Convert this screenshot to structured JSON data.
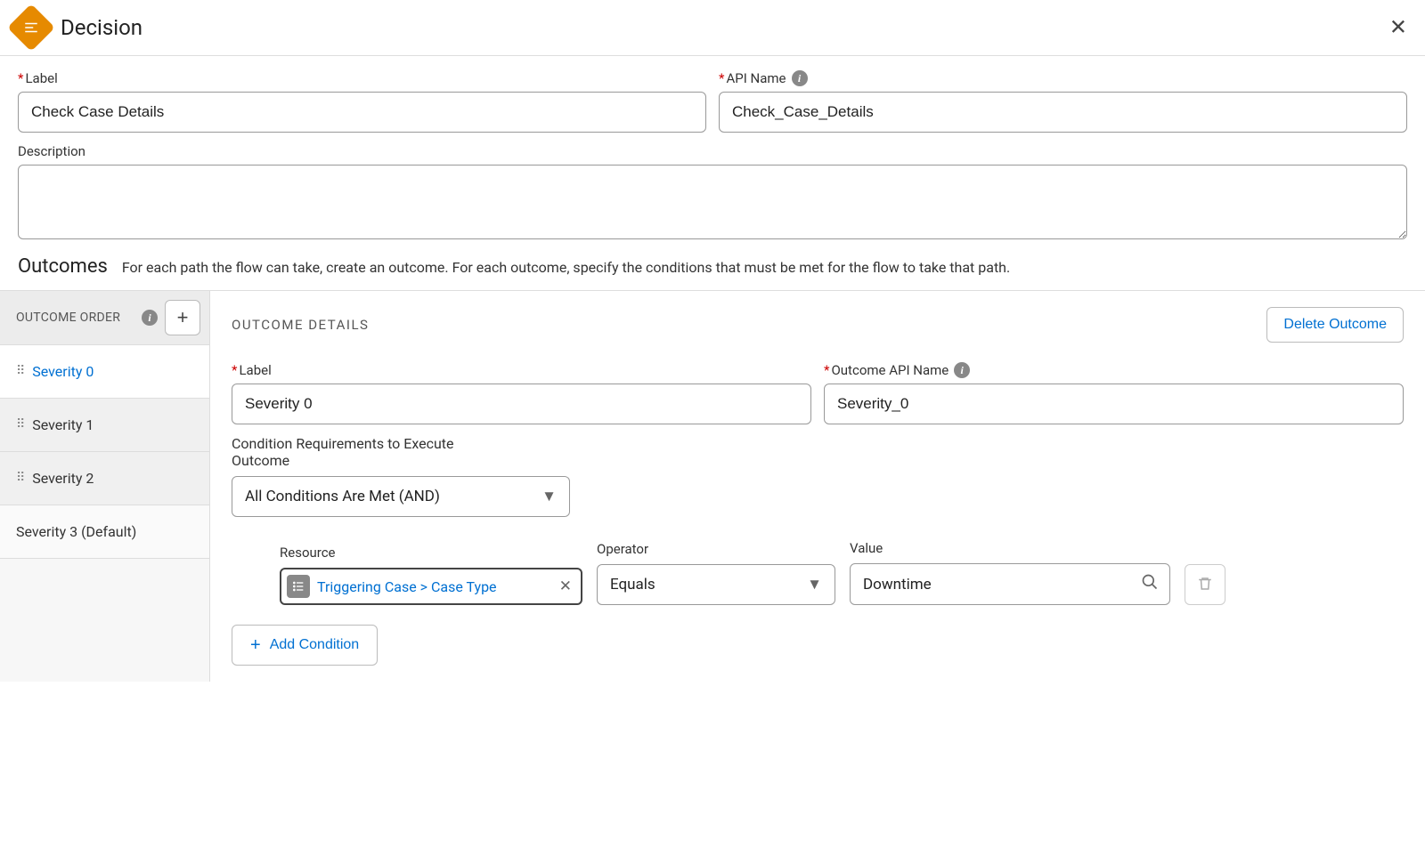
{
  "header": {
    "title": "Decision"
  },
  "fields": {
    "label_label": "Label",
    "label_value": "Check Case Details",
    "api_label": "API Name",
    "api_value": "Check_Case_Details",
    "desc_label": "Description",
    "desc_value": ""
  },
  "outcomes_section": {
    "title": "Outcomes",
    "desc": "For each path the flow can take, create an outcome. For each outcome, specify the conditions that must be met for the flow to take that path."
  },
  "sidebar": {
    "order_label": "OUTCOME ORDER",
    "items": [
      {
        "label": "Severity 0",
        "selected": true
      },
      {
        "label": "Severity 1",
        "selected": false
      },
      {
        "label": "Severity 2",
        "selected": false
      }
    ],
    "default_label": "Severity 3 (Default)"
  },
  "details": {
    "title": "OUTCOME DETAILS",
    "delete_label": "Delete Outcome",
    "label_label": "Label",
    "label_value": "Severity 0",
    "api_label": "Outcome API Name",
    "api_value": "Severity_0",
    "cond_req_label": "Condition Requirements to Execute Outcome",
    "cond_req_value": "All Conditions Are Met (AND)",
    "resource_label": "Resource",
    "resource_value": "Triggering Case > Case Type",
    "operator_label": "Operator",
    "operator_value": "Equals",
    "value_label": "Value",
    "value_value": "Downtime",
    "add_cond_label": "Add Condition"
  }
}
